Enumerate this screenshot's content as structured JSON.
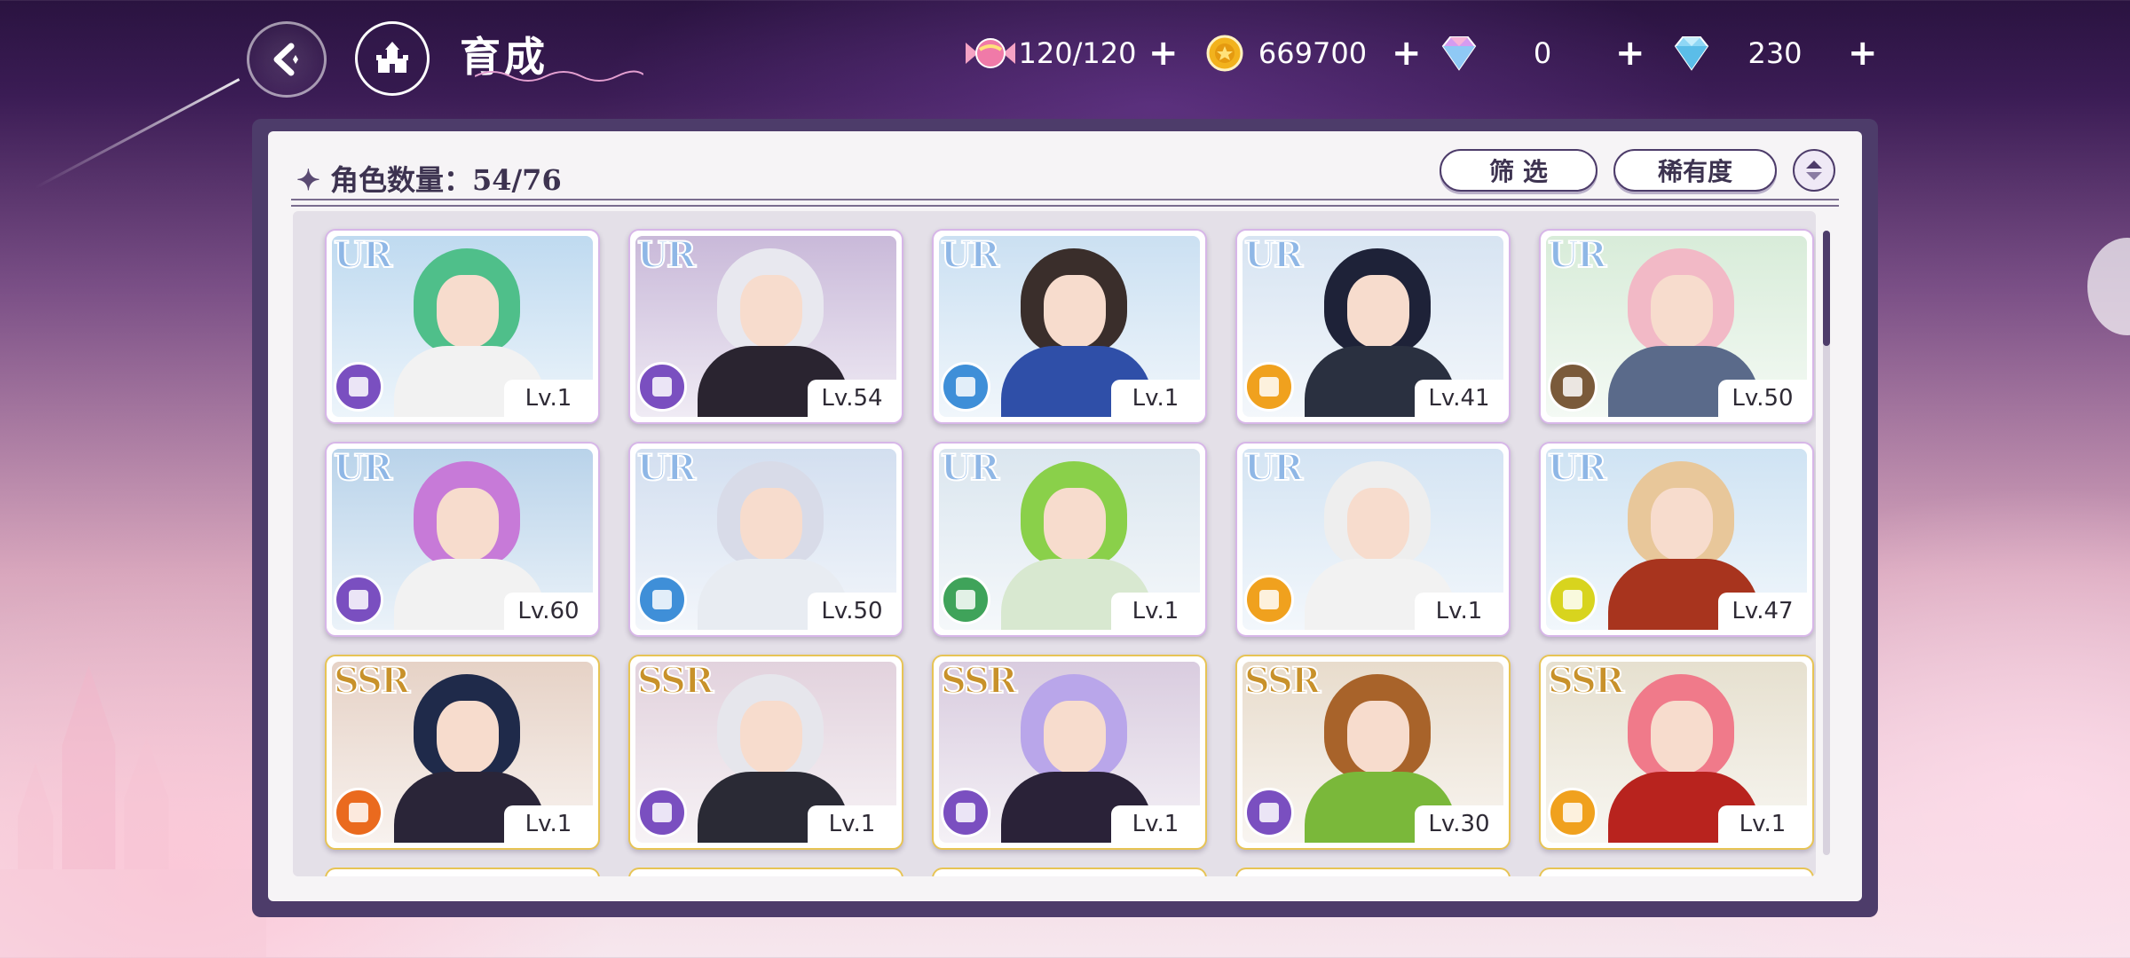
{
  "header": {
    "title": "育成",
    "resources": [
      {
        "name": "candy",
        "value": "120/120",
        "plus": "+",
        "color": "#f07aa8"
      },
      {
        "name": "gold-coin",
        "value": "669700",
        "plus": "+",
        "color": "#f2b21d"
      },
      {
        "name": "rainbow-gem",
        "value": "0",
        "plus": "+",
        "color": "#d59cf0"
      },
      {
        "name": "diamond",
        "value": "230",
        "plus": "+",
        "color": "#8fd7f5"
      }
    ]
  },
  "panel": {
    "count_label": "角色数量：54/76",
    "filter_label": "筛 选",
    "rarity_label": "稀有度"
  },
  "cards": [
    {
      "rarity": "UR",
      "level": "Lv.1",
      "attr_color": "#7a4fc0",
      "hair": "#4fbf8a",
      "outfit": "#f2f2f2",
      "sky": "#bfdaf0"
    },
    {
      "rarity": "UR",
      "level": "Lv.54",
      "attr_color": "#7a4fc0",
      "hair": "#e8e8ef",
      "outfit": "#2a2430",
      "sky": "#c9b9d9"
    },
    {
      "rarity": "UR",
      "level": "Lv.1",
      "attr_color": "#3f8fd8",
      "hair": "#3a2e2b",
      "outfit": "#2f4fa8",
      "sky": "#cbe0f2"
    },
    {
      "rarity": "UR",
      "level": "Lv.41",
      "attr_color": "#f0a11e",
      "hair": "#1e2238",
      "outfit": "#2a3040",
      "sky": "#d7e4f2"
    },
    {
      "rarity": "UR",
      "level": "Lv.50",
      "attr_color": "#7a5a3a",
      "hair": "#f2b9c6",
      "outfit": "#5a6a8a",
      "sky": "#d8ecd9"
    },
    {
      "rarity": "UR",
      "level": "Lv.60",
      "attr_color": "#7a4fc0",
      "hair": "#c77ad8",
      "outfit": "#f2f2f2",
      "sky": "#b9d3ea"
    },
    {
      "rarity": "UR",
      "level": "Lv.50",
      "attr_color": "#3f8fd8",
      "hair": "#d8dbe8",
      "outfit": "#e8ecf2",
      "sky": "#d3dff0"
    },
    {
      "rarity": "UR",
      "level": "Lv.1",
      "attr_color": "#3fa35a",
      "hair": "#8ad04a",
      "outfit": "#d8e8d0",
      "sky": "#dbe6ef"
    },
    {
      "rarity": "UR",
      "level": "Lv.1",
      "attr_color": "#f0a11e",
      "hair": "#eeeeee",
      "outfit": "#f2f2f2",
      "sky": "#d4e4f3"
    },
    {
      "rarity": "UR",
      "level": "Lv.47",
      "attr_color": "#d8d41e",
      "hair": "#e8c79a",
      "outfit": "#a8341e",
      "sky": "#cfe3f3"
    },
    {
      "rarity": "SSR",
      "level": "Lv.1",
      "attr_color": "#ea6a1e",
      "hair": "#1f2a4a",
      "outfit": "#2a2538",
      "sky": "#e6d2c6"
    },
    {
      "rarity": "SSR",
      "level": "Lv.1",
      "attr_color": "#7a4fc0",
      "hair": "#e6e6ec",
      "outfit": "#2a2a35",
      "sky": "#e2d2dd"
    },
    {
      "rarity": "SSR",
      "level": "Lv.1",
      "attr_color": "#7a4fc0",
      "hair": "#b9a6ea",
      "outfit": "#2a2238",
      "sky": "#d9ccdf"
    },
    {
      "rarity": "SSR",
      "level": "Lv.30",
      "attr_color": "#7a4fc0",
      "hair": "#a8632a",
      "outfit": "#7ab83a",
      "sky": "#e8dccc"
    },
    {
      "rarity": "SSR",
      "level": "Lv.1",
      "attr_color": "#f0a11e",
      "hair": "#f07a8a",
      "outfit": "#b8231e",
      "sky": "#e6e0cf"
    }
  ]
}
